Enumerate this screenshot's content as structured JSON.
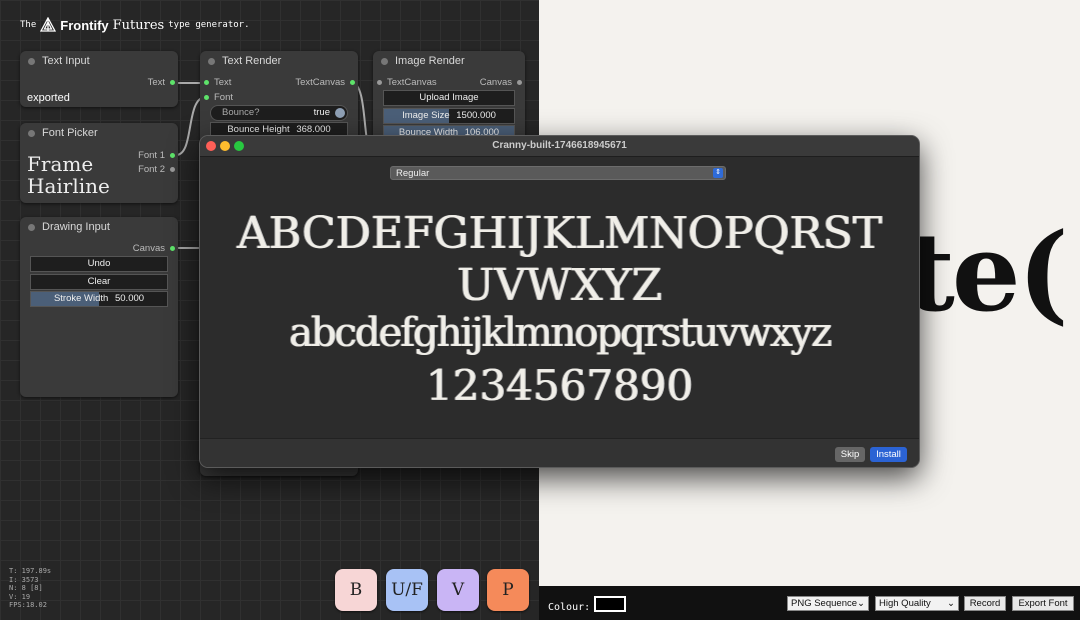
{
  "brand": {
    "prefix": "The",
    "logo_name": "Frontify",
    "futures": "Futures",
    "suffix": "type generator."
  },
  "nodes": {
    "text_input": {
      "title": "Text Input",
      "port_out": "Text",
      "value": "exported"
    },
    "font_picker": {
      "title": "Font Picker",
      "preview_line1": "Frame",
      "preview_line2": "Hairline",
      "port_font1": "Font 1",
      "port_font2": "Font 2"
    },
    "drawing_input": {
      "title": "Drawing Input",
      "port_out": "Canvas",
      "undo": "Undo",
      "clear": "Clear",
      "stroke_label": "Stroke Width",
      "stroke_value": "50.000",
      "stroke_fill": 0.5
    },
    "text_render": {
      "title": "Text Render",
      "port_text": "Text",
      "port_font": "Font",
      "port_out": "TextCanvas",
      "bounce_label": "Bounce?",
      "bounce_value": "true",
      "bounce_height_label": "Bounce Height",
      "bounce_height_value": "368.000"
    },
    "image_render": {
      "title": "Image Render",
      "port_in": "TextCanvas",
      "port_out": "Canvas",
      "upload": "Upload Image",
      "image_size_label": "Image Size",
      "image_size_value": "1500.000",
      "bounce_width_label": "Bounce Width",
      "bounce_width_value": "106.000"
    }
  },
  "stats": [
    "T: 197.89s",
    "I: 3573",
    "N: 8 [8]",
    "V: 19",
    "FPS:18.02"
  ],
  "pills": [
    {
      "label": "B",
      "color": "#f7d6d6"
    },
    {
      "label": "U/F",
      "color": "#a8c2f5"
    },
    {
      "label": "V",
      "color": "#c9b5f5"
    },
    {
      "label": "P",
      "color": "#f58a5a"
    }
  ],
  "preview": {
    "text": "te("
  },
  "bottom": {
    "colour_label": "Colour:",
    "colour_value": "#000000",
    "format": "PNG Sequence",
    "quality": "High Quality",
    "record": "Record",
    "export": "Export Font"
  },
  "dialog": {
    "title": "Cranny-built-1746618945671",
    "style": "Regular",
    "specimen_upper1": "ABCDEFGHIJKLMNOPQRST",
    "specimen_upper2": "UVWXYZ",
    "specimen_lower": "abcdefghijklmnopqrstuvwxyz",
    "specimen_digits": "1234567890",
    "skip": "Skip",
    "install": "Install"
  }
}
